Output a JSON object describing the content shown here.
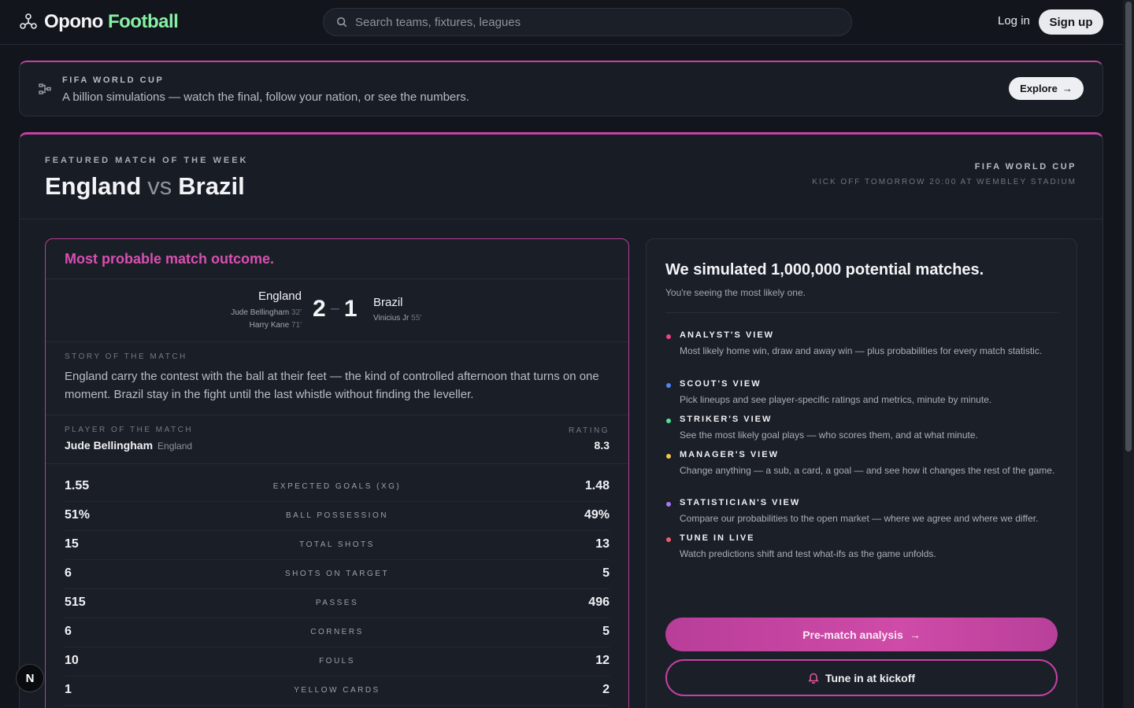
{
  "header": {
    "logo_part1": "Opono",
    "logo_part2": "Football",
    "search_placeholder": "Search teams, fixtures, leagues",
    "login_label": "Log in",
    "signup_label": "Sign up"
  },
  "banner": {
    "eyebrow": "FIFA WORLD CUP",
    "text": "A billion simulations — watch the final, follow your nation, or see the numbers.",
    "button_label": "Explore",
    "button_arrow": "→"
  },
  "featured": {
    "eyebrow": "FEATURED MATCH OF THE WEEK",
    "home_team": "England",
    "vs_label": "vs",
    "away_team": "Brazil",
    "competition": "FIFA WORLD CUP",
    "kickoff": "KICK OFF TOMORROW 20:00 AT WEMBLEY STADIUM"
  },
  "outcome": {
    "title": "Most probable match outcome.",
    "home_team": "England",
    "away_team": "Brazil",
    "home_score": "2",
    "score_separator": "–",
    "away_score": "1",
    "home_scorers": [
      {
        "name": "Jude Bellingham",
        "minute": "32'"
      },
      {
        "name": "Harry Kane",
        "minute": "71'"
      }
    ],
    "away_scorers": [
      {
        "name": "Vinicius Jr",
        "minute": "55'"
      }
    ],
    "story_label": "STORY OF THE MATCH",
    "story_text": "England carry the contest with the ball at their feet — the kind of controlled afternoon that turns on one moment. Brazil stay in the fight until the last whistle without finding the leveller.",
    "potm_label": "PLAYER OF THE MATCH",
    "potm_name": "Jude Bellingham",
    "potm_team": "England",
    "rating_label": "RATING",
    "rating_value": "8.3",
    "stats": [
      {
        "home": "1.55",
        "label": "EXPECTED GOALS (XG)",
        "away": "1.48"
      },
      {
        "home": "51%",
        "label": "BALL POSSESSION",
        "away": "49%"
      },
      {
        "home": "15",
        "label": "TOTAL SHOTS",
        "away": "13"
      },
      {
        "home": "6",
        "label": "SHOTS ON TARGET",
        "away": "5"
      },
      {
        "home": "515",
        "label": "PASSES",
        "away": "496"
      },
      {
        "home": "6",
        "label": "CORNERS",
        "away": "5"
      },
      {
        "home": "10",
        "label": "FOULS",
        "away": "12"
      },
      {
        "home": "1",
        "label": "YELLOW CARDS",
        "away": "2"
      }
    ]
  },
  "simulation": {
    "title": "We simulated 1,000,000 potential matches.",
    "subtitle": "You're seeing the most likely one.",
    "views": [
      {
        "title": "ANALYST'S VIEW",
        "desc": "Most likely home win, draw and away win — plus probabilities for every match statistic.",
        "color": "#f0457e"
      },
      {
        "title": "SCOUT'S VIEW",
        "desc": "Pick lineups and see player-specific ratings and metrics, minute by minute.",
        "color": "#4f86f7"
      },
      {
        "title": "STRIKER'S VIEW",
        "desc": "See the most likely goal plays — who scores them, and at what minute.",
        "color": "#4ee39a"
      },
      {
        "title": "MANAGER'S VIEW",
        "desc": "Change anything — a sub, a card, a goal — and see how it changes the rest of the game.",
        "color": "#f2c94c"
      },
      {
        "title": "STATISTICIAN'S VIEW",
        "desc": "Compare our probabilities to the open market — where we agree and where we differ.",
        "color": "#a879f2"
      },
      {
        "title": "TUNE IN LIVE",
        "desc": "Watch predictions shift and test what-ifs as the game unfolds.",
        "color": "#f05a6b"
      }
    ],
    "primary_button": "Pre-match analysis",
    "primary_arrow": "→",
    "secondary_button": "Tune in at kickoff"
  },
  "badge_letter": "N",
  "colors": {
    "accent": "#c542a3",
    "brand_green": "#86f0a4",
    "background": "#12151c"
  }
}
